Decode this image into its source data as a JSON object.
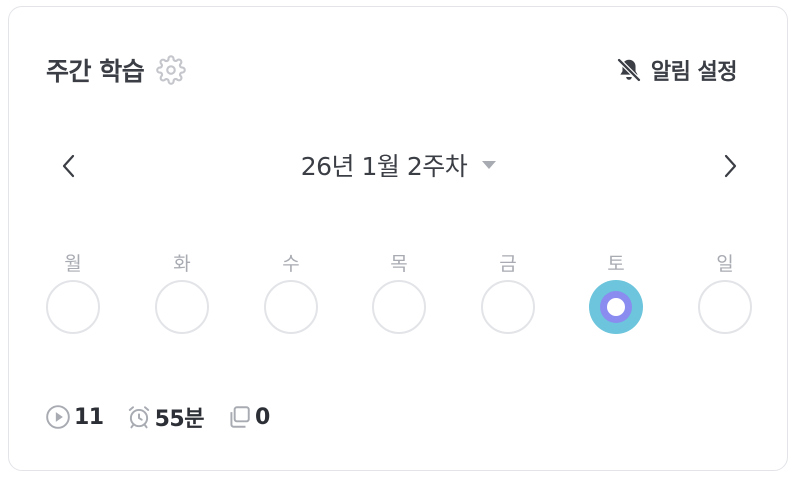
{
  "header": {
    "title": "주간 학습",
    "settings_icon": "gear-icon",
    "alarm_label": "알림 설정",
    "alarm_icon": "bell-off-icon"
  },
  "week_nav": {
    "label": "26년 1월 2주차",
    "prev_icon": "chevron-left-icon",
    "next_icon": "chevron-right-icon",
    "dropdown_icon": "caret-down-icon"
  },
  "days": [
    {
      "name": "월",
      "state": "empty"
    },
    {
      "name": "화",
      "state": "empty"
    },
    {
      "name": "수",
      "state": "empty"
    },
    {
      "name": "목",
      "state": "empty"
    },
    {
      "name": "금",
      "state": "empty"
    },
    {
      "name": "토",
      "state": "today"
    },
    {
      "name": "일",
      "state": "empty"
    }
  ],
  "stats": {
    "plays": {
      "icon": "play-circle-icon",
      "value": "11"
    },
    "time": {
      "icon": "alarm-clock-icon",
      "value": "55분"
    },
    "copies": {
      "icon": "copy-icon",
      "value": "0"
    }
  },
  "colors": {
    "today_outer": "#6cc5dc",
    "today_inner": "#8a8cf0",
    "text_primary": "#3b3e45",
    "text_muted": "#a8abb2",
    "border": "#e3e4e8"
  }
}
